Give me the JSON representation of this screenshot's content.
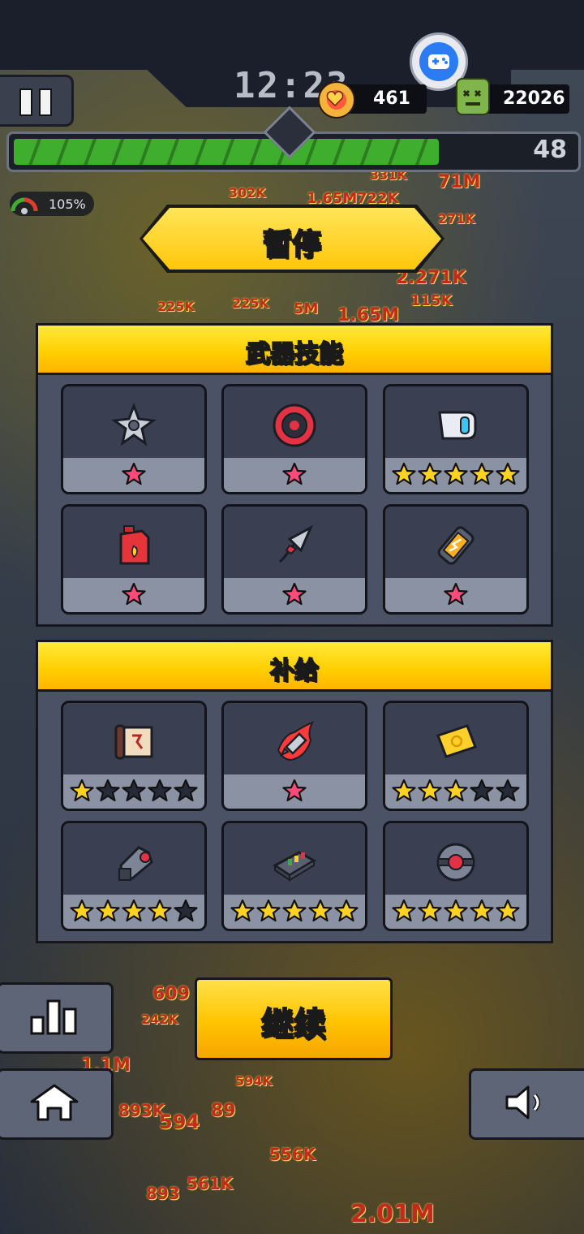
{
  "hud": {
    "timer": "12:23",
    "gems": "461",
    "kills": "22026",
    "level": "48",
    "xp_progress": 0.76,
    "speed": "105%"
  },
  "background_damage_numbers": [
    "331K",
    "302K",
    "1.65M",
    "722K",
    "71M",
    "271K",
    "225K",
    "225K",
    "2.271K",
    "115K",
    "5M",
    "1.65M",
    "609",
    "242K",
    "594K",
    "893K",
    "594",
    "89",
    "556K",
    "561K",
    "893",
    "2.01M",
    "1.1M"
  ],
  "pause_title": "暂停",
  "weapons_panel": {
    "title": "武器技能",
    "items": [
      {
        "name": "shuriken",
        "stars_filled": 1,
        "stars_total": 1,
        "star_color": "pink"
      },
      {
        "name": "red-disc",
        "stars_filled": 1,
        "stars_total": 1,
        "star_color": "pink"
      },
      {
        "name": "drone-pod",
        "stars_filled": 5,
        "stars_total": 5,
        "star_color": "gold"
      },
      {
        "name": "fuel-can",
        "stars_filled": 1,
        "stars_total": 1,
        "star_color": "pink"
      },
      {
        "name": "kunai",
        "stars_filled": 1,
        "stars_total": 1,
        "star_color": "pink"
      },
      {
        "name": "energy-canister",
        "stars_filled": 1,
        "stars_total": 1,
        "star_color": "pink"
      }
    ]
  },
  "supplies_panel": {
    "title": "补给",
    "items": [
      {
        "name": "scroll",
        "stars_filled": 1,
        "stars_total": 5,
        "star_color": "gold"
      },
      {
        "name": "flame-bullet",
        "stars_filled": 1,
        "stars_total": 1,
        "star_color": "pink"
      },
      {
        "name": "gold-ticket",
        "stars_filled": 3,
        "stars_total": 5,
        "star_color": "gold"
      },
      {
        "name": "arm-cannon",
        "stars_filled": 4,
        "stars_total": 5,
        "star_color": "gold"
      },
      {
        "name": "battery-pack",
        "stars_filled": 5,
        "stars_total": 5,
        "star_color": "gold"
      },
      {
        "name": "core-orb",
        "stars_filled": 5,
        "stars_total": 5,
        "star_color": "gold"
      }
    ]
  },
  "continue_label": "继续",
  "colors": {
    "star_gold": "#ffd21f",
    "star_pink": "#ff4a7a",
    "star_empty": "#262b38",
    "accent_yellow": "#ffcd00"
  },
  "icons": [
    "pause-icon",
    "controller-icon",
    "gem-icon",
    "kill-icon",
    "stats-icon",
    "home-icon",
    "speaker-icon"
  ]
}
